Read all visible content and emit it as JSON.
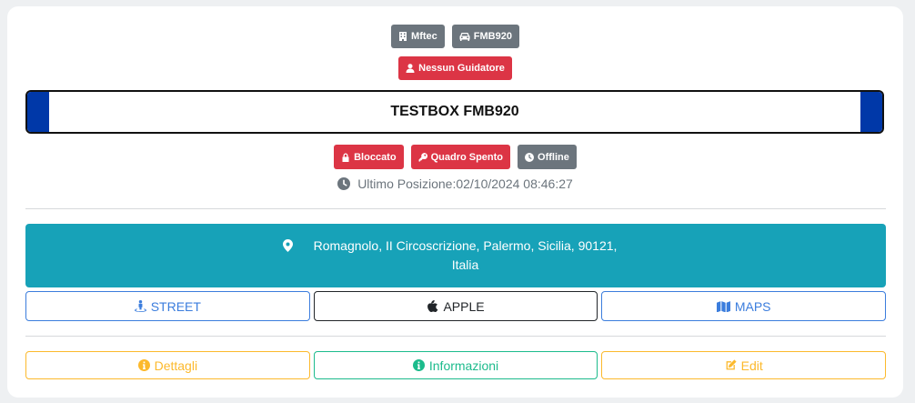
{
  "header": {
    "company_badge": "Mftec",
    "vehicle_badge": "FMB920",
    "driver_badge": "Nessun Guidatore"
  },
  "vehicle": {
    "title": "TESTBOX FMB920"
  },
  "status": {
    "lock": "Bloccato",
    "ignition": "Quadro Spento",
    "connection": "Offline",
    "last_position": "Ultimo Posizione:02/10/2024 08:46:27"
  },
  "address": {
    "line": "Romagnolo, II Circoscrizione, Palermo, Sicilia, 90121, Italia"
  },
  "map_buttons": {
    "street": "STREET",
    "apple": "APPLE",
    "maps": "MAPS"
  },
  "action_buttons": {
    "details": "Dettagli",
    "info": "Informazioni",
    "edit": "Edit"
  },
  "colors": {
    "secondary": "#6c757d",
    "danger": "#dc3545",
    "info": "#17a2b8",
    "primary": "#3b7ddd",
    "warning": "#fcb92c",
    "success": "#1cbb8c",
    "plate_blue": "#0038a8"
  },
  "icons": {
    "company": "building-icon",
    "vehicle": "car-icon",
    "driver": "user-icon",
    "lock": "lock-icon",
    "ignition": "key-icon",
    "connection": "clock-icon",
    "last_position": "clock-icon",
    "address": "map-marker-icon",
    "street": "street-view-icon",
    "apple": "apple-icon",
    "maps": "map-icon",
    "details": "info-circle-icon",
    "info": "info-circle-icon",
    "edit": "edit-icon"
  }
}
